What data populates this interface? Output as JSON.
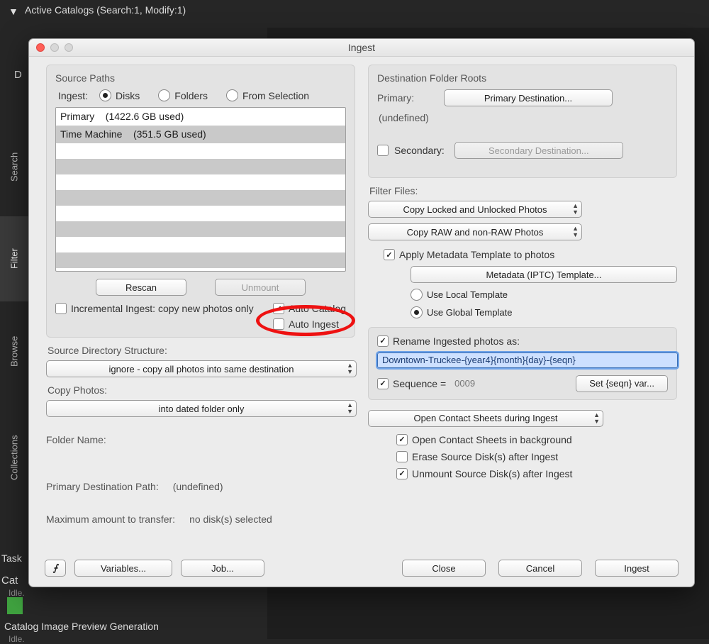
{
  "bg": {
    "panel_header": "Active Catalogs (Search:1, Modify:1)",
    "d_letter": "D",
    "tabs": {
      "search": "Search",
      "filter": "Filter",
      "browse": "Browse",
      "collections": "Collections"
    },
    "tasks_label": "Task",
    "cat_label": "Cat",
    "idle": "Idle.",
    "cipg": "Catalog Image Preview Generation"
  },
  "dialog": {
    "title": "Ingest",
    "source": {
      "group_title": "Source Paths",
      "ingest_label": "Ingest:",
      "radios": {
        "disks": "Disks",
        "folders": "Folders",
        "from_selection": "From Selection"
      },
      "disks": [
        {
          "name": "Primary",
          "used": "(1422.6 GB used)"
        },
        {
          "name": "Time Machine",
          "used": "(351.5 GB used)"
        }
      ],
      "rescan_btn": "Rescan",
      "unmount_btn": "Unmount",
      "incremental": "Incremental Ingest: copy new photos only",
      "auto_catalog": "Auto Catalog",
      "auto_ingest": "Auto Ingest"
    },
    "sds": {
      "label": "Source Directory Structure:",
      "value": "ignore - copy all photos into same destination"
    },
    "copy_photos": {
      "label": "Copy Photos:",
      "value": "into dated folder only"
    },
    "folder_name": {
      "label": "Folder Name:",
      "value": ""
    },
    "pdp": {
      "label": "Primary Destination Path:",
      "value": "(undefined)"
    },
    "max_transfer": {
      "label": "Maximum amount to transfer:",
      "value": "no disk(s) selected"
    },
    "lightning": "⨍",
    "variables_btn": "Variables...",
    "job_btn": "Job...",
    "dest": {
      "group_title": "Destination Folder Roots",
      "primary_label": "Primary:",
      "primary_btn": "Primary Destination...",
      "primary_value": "(undefined)",
      "secondary_label": "Secondary:",
      "secondary_btn": "Secondary Destination..."
    },
    "filter": {
      "label": "Filter Files:",
      "locked": "Copy Locked and Unlocked Photos",
      "raw": "Copy RAW and non-RAW Photos"
    },
    "meta": {
      "apply": "Apply Metadata Template to photos",
      "template_btn": "Metadata (IPTC) Template...",
      "use_local": "Use Local Template",
      "use_global": "Use Global Template"
    },
    "rename": {
      "check": "Rename Ingested photos as:",
      "value": "Downtown-Truckee-{year4}{month}{day}-{seqn}",
      "seq_check": "Sequence =",
      "seq_value": "0009",
      "set_seqn_btn": "Set {seqn} var..."
    },
    "contact": {
      "open_popup": "Open Contact Sheets during Ingest",
      "bg": "Open Contact Sheets in background",
      "erase": "Erase Source Disk(s) after Ingest",
      "unmount": "Unmount Source Disk(s) after Ingest"
    },
    "footer": {
      "close": "Close",
      "cancel": "Cancel",
      "ingest": "Ingest"
    }
  }
}
